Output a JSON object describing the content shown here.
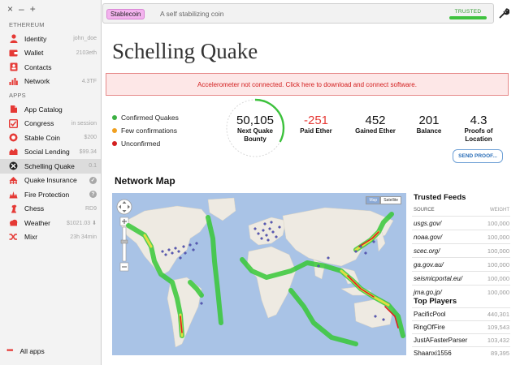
{
  "window_controls": [
    "×",
    "–",
    "+"
  ],
  "sidebar": {
    "section_ethereum": "ETHEREUM",
    "section_apps": "APPS",
    "ethereum_items": [
      {
        "label": "Identity",
        "meta": "john_doe",
        "icon": "person-icon"
      },
      {
        "label": "Wallet",
        "meta": "2103eth",
        "icon": "wallet-icon"
      },
      {
        "label": "Contacts",
        "meta": "",
        "icon": "contacts-icon"
      },
      {
        "label": "Network",
        "meta": "4.3TF",
        "icon": "bar-chart-icon"
      }
    ],
    "app_items": [
      {
        "label": "App Catalog",
        "meta": "",
        "icon": "catalog-icon"
      },
      {
        "label": "Congress",
        "meta": "in session",
        "icon": "checkbox-icon"
      },
      {
        "label": "Stable Coin",
        "meta": "$200",
        "icon": "coin-icon"
      },
      {
        "label": "Social Lending",
        "meta": "$99.34",
        "icon": "lending-icon"
      },
      {
        "label": "Schelling Quake",
        "meta": "0.1",
        "icon": "quake-icon",
        "selected": true
      },
      {
        "label": "Quake Insurance",
        "meta": "",
        "icon": "insurance-icon",
        "badge": "✓"
      },
      {
        "label": "Fire Protection",
        "meta": "",
        "icon": "fire-icon",
        "badge": "?"
      },
      {
        "label": "Chess",
        "meta": "RD9",
        "icon": "chess-icon"
      },
      {
        "label": "Weather",
        "meta": "$1021.03 ⬇",
        "icon": "weather-icon"
      },
      {
        "label": "Mixr",
        "meta": "23h 34min",
        "icon": "mixr-icon"
      }
    ],
    "all_apps": "All apps",
    "all_apps_dots": "•••"
  },
  "topbar": {
    "tag": "Stablecoin",
    "title": "A self stabilizing coin",
    "trusted": "TRUSTED"
  },
  "page": {
    "title": "Schelling Quake",
    "alert": "Accelerometer not connected. Click here to download and connect software."
  },
  "legend": [
    {
      "label": "Confirmed Quakes",
      "color": "#3cb043"
    },
    {
      "label": "Few confirmations",
      "color": "#f0a020"
    },
    {
      "label": "Unconfirmed",
      "color": "#d32020"
    }
  ],
  "bounty_progress": 0.33,
  "stats": {
    "bounty": {
      "value": "50,105",
      "label_1": "Next Quake",
      "label_2": "Bounty"
    },
    "ether": {
      "value": "-251",
      "label_1": "Paid Ether",
      "label_2": ""
    },
    "gained": {
      "value": "452",
      "label_1": "Gained Ether",
      "label_2": ""
    },
    "balance": {
      "value": "201",
      "label_1": "Balance",
      "label_2": ""
    },
    "proofs": {
      "value": "4.3",
      "label_1": "Proofs of",
      "label_2": "Location"
    }
  },
  "send_proof": "SEND PROOF...",
  "map": {
    "heading": "Network Map",
    "toggle_map": "Map",
    "toggle_satellite": "Satellite"
  },
  "feeds": {
    "title": "Trusted Feeds",
    "col_source": "SOURCE",
    "col_weight": "WEIGHT",
    "rows": [
      {
        "source": "usgs.gov/",
        "weight": "100,000"
      },
      {
        "source": "noaa.gov/",
        "weight": "100,000"
      },
      {
        "source": "scec.org/",
        "weight": "100,000"
      },
      {
        "source": "ga.gov.au/",
        "weight": "100,000"
      },
      {
        "source": "seismicportal.eu/",
        "weight": "100,000"
      },
      {
        "source": "jma.go.jp/",
        "weight": "100,000"
      }
    ]
  },
  "players": {
    "title": "Top Players",
    "rows": [
      {
        "name": "PacificPool",
        "score": "440,301"
      },
      {
        "name": "RingOfFire",
        "score": "109,543"
      },
      {
        "name": "JustAFasterParser",
        "score": "103,432"
      },
      {
        "name": "Shaanxi1556",
        "score": "89,395"
      }
    ]
  }
}
